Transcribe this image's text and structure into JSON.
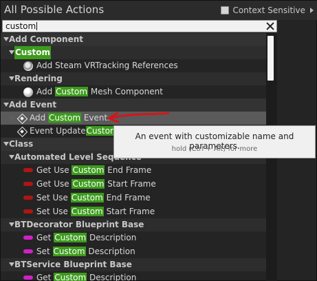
{
  "window": {
    "title": "All Possible Actions",
    "context_sensitive_label": "Context Sensitive",
    "context_sensitive_checked": true
  },
  "search": {
    "value": "custom"
  },
  "tree": {
    "add_component": "Add Component",
    "custom_cat": "Custom",
    "steam_item": "Add Steam VRTracking References",
    "rendering_cat": "Rendering",
    "add_mesh_pre": "Add ",
    "add_mesh_hl": "Custom",
    "add_mesh_post": " Mesh Component",
    "add_event_cat": "Add Event",
    "add_custom_event_pre": "Add ",
    "add_custom_event_hl": "Custom",
    "add_custom_event_post": " Event...",
    "event_update_pre": "Event Update",
    "event_update_hl": "Custom",
    "class_cat": "Class",
    "auto_level_cat": "Automated Level Sequence",
    "get_use_end_pre": "Get Use ",
    "get_use_end_hl": "Custom",
    "get_use_end_post": " End Frame",
    "get_use_start_pre": "Get Use ",
    "get_use_start_hl": "Custom",
    "get_use_start_post": " Start Frame",
    "set_use_end_pre": "Set Use ",
    "set_use_end_hl": "Custom",
    "set_use_end_post": " End Frame",
    "set_use_start_pre": "Set Use ",
    "set_use_start_hl": "Custom",
    "set_use_start_post": " Start Frame",
    "btdecorator_cat": "BTDecorator Blueprint Base",
    "get_desc_pre": "Get ",
    "get_desc_hl": "Custom",
    "get_desc_post": " Description",
    "set_desc_pre": "Set ",
    "set_desc_hl": "Custom",
    "set_desc_post": " Description",
    "btservice_cat": "BTService Blueprint Base",
    "get_desc2_pre": "Get ",
    "get_desc2_hl": "Custom",
    "get_desc2_post": " Description"
  },
  "tooltip": {
    "main": "An event with customizable name and parameters.",
    "sub": "hold (Ctrl + Alt) for more"
  },
  "colors": {
    "highlight": "#3d9b1c",
    "annotation_arrow": "#d4151a"
  },
  "icons": {
    "clear": "close-icon",
    "component": "gear-icon",
    "mesh": "sphere-icon",
    "event": "event-diamond-icon",
    "function_red": "function-icon",
    "function_magenta": "function-icon"
  }
}
